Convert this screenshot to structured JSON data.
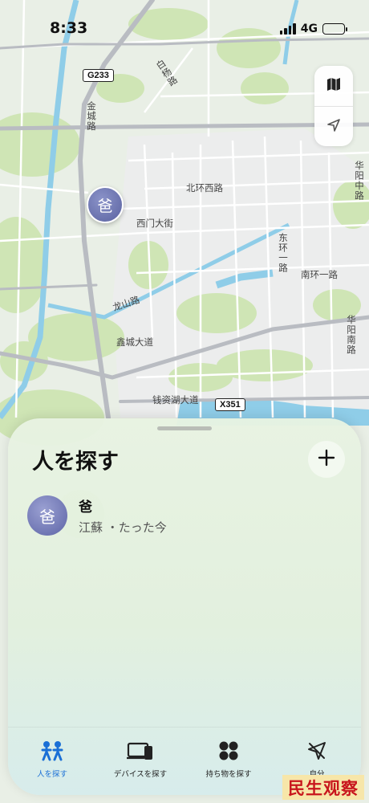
{
  "status_bar": {
    "time": "8:33",
    "network": "4G"
  },
  "map": {
    "labels": {
      "bai_yang_road": "白杨路",
      "jin_cheng_road": "金城路",
      "bei_huan_xi_road": "北环西路",
      "xi_men_da_jie": "西门大街",
      "hua_yang_zhong_road": "华阳中路",
      "dong_huan_yi_road": "东环一路",
      "nan_huan_yi_road": "南环一路",
      "long_shan_road": "龙山路",
      "xin_cheng_da_dao": "鑫城大道",
      "hua_yang_nan_road": "华阳南路",
      "qian_zi_hu_da_dao": "钱资湖大道"
    },
    "shields": {
      "g233": "G233",
      "x351": "X351"
    },
    "person_pin": {
      "initial": "爸"
    },
    "controls": {
      "map_mode_icon": "map-icon",
      "location_icon": "location-arrow-icon"
    },
    "colors": {
      "land": "#e9efe6",
      "park": "#cfe5b5",
      "water": "#8fcde8",
      "road": "#ffffff",
      "major_road": "#b9bcc2"
    }
  },
  "sheet": {
    "title": "人を探す",
    "add_label": "+",
    "people": [
      {
        "initial": "爸",
        "name": "爸",
        "location": "江蘇",
        "separator": " ・",
        "time": "たった今"
      }
    ],
    "tabs": [
      {
        "label": "人を探す",
        "icon": "people-icon",
        "active": true
      },
      {
        "label": "デバイスを探す",
        "icon": "devices-icon",
        "active": false
      },
      {
        "label": "持ち物を探す",
        "icon": "items-icon",
        "active": false
      },
      {
        "label": "自分",
        "icon": "me-icon",
        "active": false
      }
    ],
    "accent_color": "#1a6fd6"
  },
  "watermark": {
    "text": "民生观察"
  }
}
